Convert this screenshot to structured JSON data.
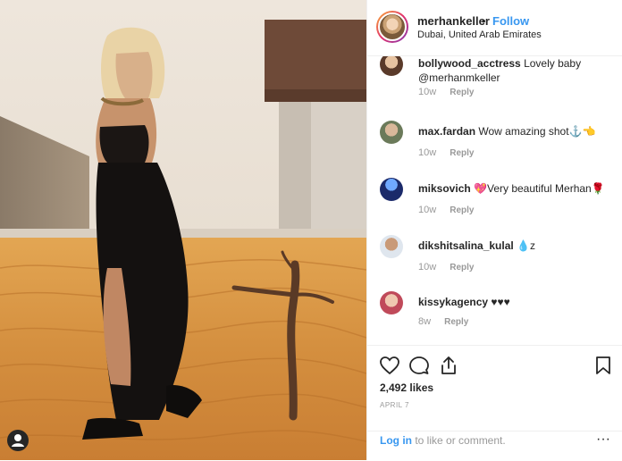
{
  "header": {
    "username": "merhankeller",
    "separator": "•",
    "follow_label": "Follow",
    "location": "Dubai, United Arab Emirates"
  },
  "comments": [
    {
      "user": "bollywood_acctress",
      "text": "Lovely baby @merhanmkeller",
      "age": "10w",
      "reply": "Reply"
    },
    {
      "user": "max.fardan",
      "text": "Wow amazing shot⚓👈",
      "age": "10w",
      "reply": "Reply"
    },
    {
      "user": "miksovich",
      "text": "💖Very beautiful Merhan🌹",
      "age": "10w",
      "reply": "Reply"
    },
    {
      "user": "dikshitsalina_kulal",
      "text": "💧z",
      "age": "10w",
      "reply": "Reply"
    },
    {
      "user": "kissykagency",
      "text": "♥♥♥",
      "age": "8w",
      "reply": "Reply"
    }
  ],
  "post": {
    "likes": "2,492 likes",
    "date": "APRIL 7"
  },
  "login": {
    "link": "Log in",
    "rest": " to like or comment."
  },
  "more_label": "···",
  "icons": {
    "like": "heart-icon",
    "comment": "comment-icon",
    "share": "share-icon",
    "save": "bookmark-icon"
  },
  "colors": {
    "accent": "#3897f0",
    "text": "#262626",
    "muted": "#999999",
    "sand": "#d99a4a"
  }
}
